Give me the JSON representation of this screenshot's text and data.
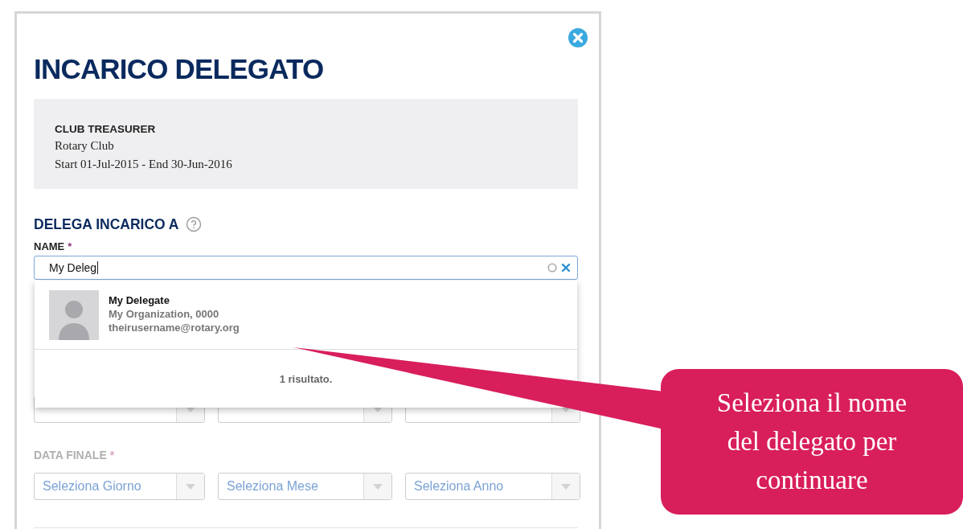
{
  "dialog": {
    "title": "INCARICO DELEGATO"
  },
  "role_card": {
    "title": "CLUB TREASURER",
    "organization": "Rotary Club",
    "term": "Start 01-Jul-2015 - End 30-Jun-2016"
  },
  "section": {
    "title": "DELEGA INCARICO A"
  },
  "name_field": {
    "label": "NAME",
    "required_mark": "*",
    "value": "My Deleg",
    "loading": true
  },
  "suggestions": [
    {
      "name": "My Delegate",
      "organization": "My Organization, 0000",
      "email": "theirusername@rotary.org"
    }
  ],
  "result_count": "1 risultato.",
  "date_rows": [
    {
      "kind": "covered"
    },
    {
      "kind": "selects",
      "label": "DATA FINALE",
      "required_mark": "*",
      "selects": [
        "Seleziona Giorno",
        "Seleziona Mese",
        "Seleziona Anno"
      ]
    }
  ],
  "callout": {
    "text": "Seleziona il nome del delegato per continuare"
  }
}
